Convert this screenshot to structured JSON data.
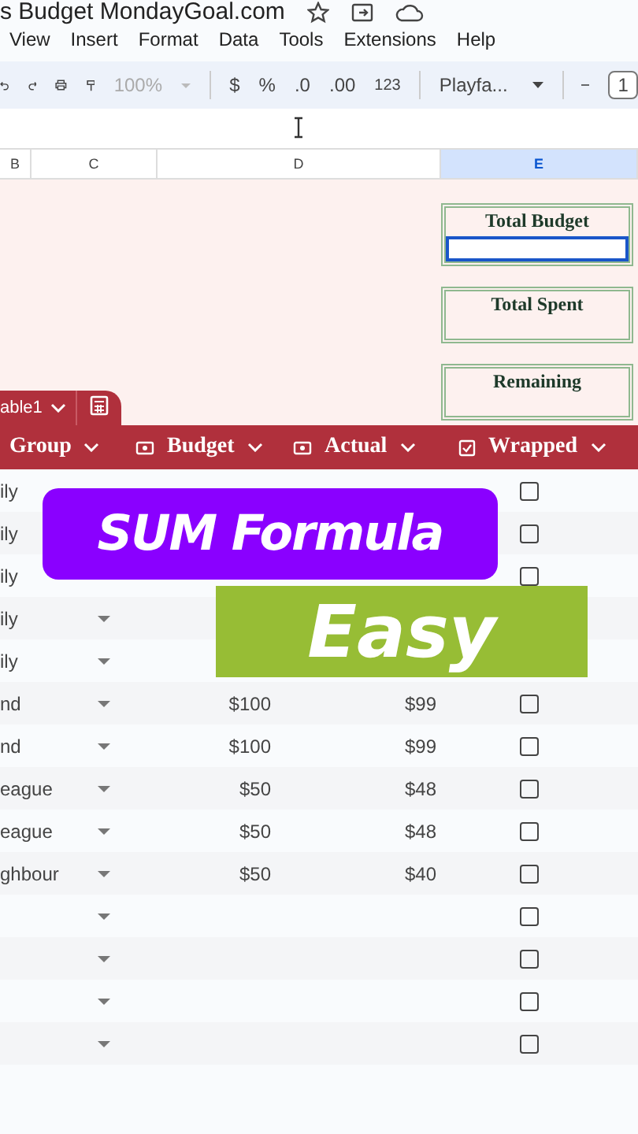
{
  "title_bar": {
    "title": "s Budget MondayGoal.com"
  },
  "menu": [
    "View",
    "Insert",
    "Format",
    "Data",
    "Tools",
    "Extensions",
    "Help"
  ],
  "toolbar": {
    "zoom": "100%",
    "currency": "$",
    "percent": "%",
    "decrease_decimal": ".0",
    "increase_decimal": ".00",
    "number_format": "123",
    "font": "Playfa...",
    "font_size": "1"
  },
  "column_headers": [
    {
      "label": "B",
      "selected": false
    },
    {
      "label": "C",
      "selected": false
    },
    {
      "label": "D",
      "selected": false
    },
    {
      "label": "E",
      "selected": true
    }
  ],
  "summary_boxes": [
    {
      "label": "Total Budget",
      "selected": true
    },
    {
      "label": "Total Spent",
      "selected": false
    },
    {
      "label": "Remaining",
      "selected": false
    }
  ],
  "table": {
    "name": "able1",
    "columns": [
      {
        "label": "Group",
        "kind": "plain"
      },
      {
        "label": "Budget",
        "kind": "money"
      },
      {
        "label": "Actual",
        "kind": "money"
      },
      {
        "label": "Wrapped",
        "kind": "check"
      }
    ],
    "rows": [
      {
        "group": "ily",
        "wrapped": false
      },
      {
        "group": "ily",
        "wrapped": false
      },
      {
        "group": "ily",
        "wrapped": false
      },
      {
        "group": "ily"
      },
      {
        "group": "ily"
      },
      {
        "group": "nd",
        "budget": "$100",
        "actual": "$99",
        "wrapped": false
      },
      {
        "group": "nd",
        "budget": "$100",
        "actual": "$99",
        "wrapped": false
      },
      {
        "group": "eague",
        "budget": "$50",
        "actual": "$48",
        "wrapped": false
      },
      {
        "group": "eague",
        "budget": "$50",
        "actual": "$48",
        "wrapped": false
      },
      {
        "group": "ghbour",
        "budget": "$50",
        "actual": "$40",
        "wrapped": false
      },
      {
        "wrapped": false
      },
      {
        "wrapped": false
      },
      {
        "wrapped": false
      },
      {
        "wrapped": false
      }
    ]
  },
  "overlays": [
    {
      "text": "SUM Formula",
      "color": "#8a00ff"
    },
    {
      "text": "Easy",
      "color": "#97bd35"
    }
  ]
}
